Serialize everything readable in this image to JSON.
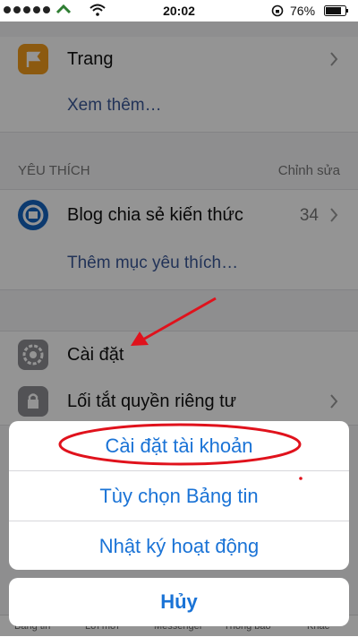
{
  "status_bar": {
    "time": "20:02",
    "battery": "76%"
  },
  "menu": {
    "pages_label": "Trang",
    "see_more": "Xem thêm…",
    "favorites_header": "YÊU THÍCH",
    "favorites_edit": "Chỉnh sửa",
    "blog_label": "Blog chia sẻ kiến thức",
    "blog_count": "34",
    "add_favorite": "Thêm mục yêu thích…",
    "settings_label": "Cài đặt",
    "privacy_label": "Lối tắt quyền riêng tư"
  },
  "tab_bar": {
    "items": [
      "Bảng tin",
      "Lời mời",
      "Messenger",
      "Thông báo",
      "Khác"
    ]
  },
  "action_sheet": {
    "items": [
      "Cài đặt tài khoản",
      "Tùy chọn Bảng tin",
      "Nhật ký hoạt động"
    ],
    "cancel": "Hủy"
  },
  "colors": {
    "accent": "#1a73d6",
    "annotation": "#e0121c",
    "link": "#3b5998"
  },
  "icons": [
    "pages-flag-icon",
    "blog-logo-icon",
    "settings-gear-icon",
    "privacy-lock-icon",
    "chevron-right-icon",
    "wifi-icon",
    "battery-icon",
    "rotation-lock-icon"
  ]
}
